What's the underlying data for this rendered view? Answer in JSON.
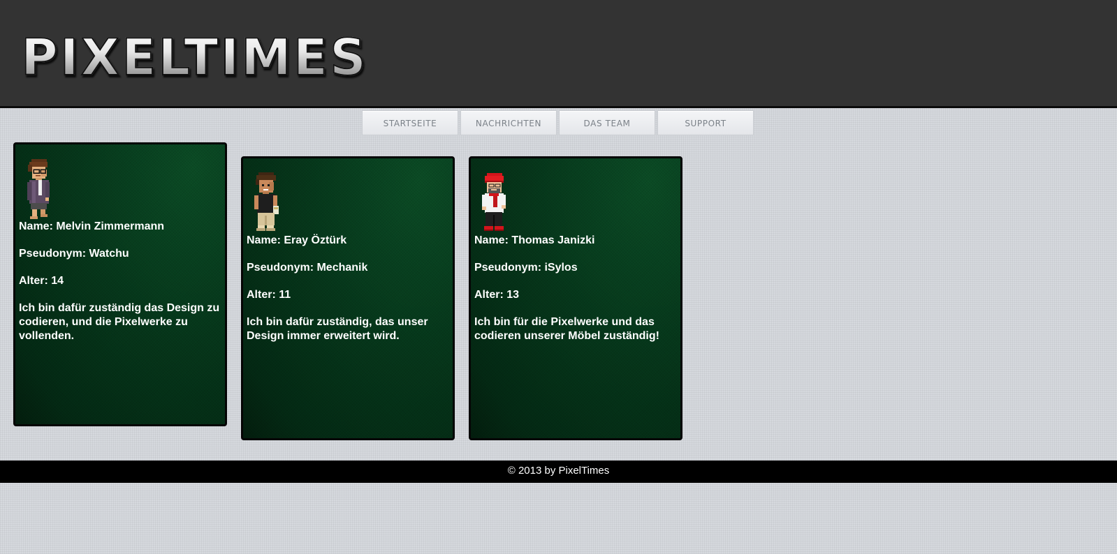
{
  "header": {
    "logo_text": "PIXELTIMES"
  },
  "nav": {
    "items": [
      {
        "label": "STARTSEITE"
      },
      {
        "label": "NACHRICHTEN"
      },
      {
        "label": "DAS TEAM"
      },
      {
        "label": "SUPPORT"
      }
    ]
  },
  "team": [
    {
      "name": "Name: Melvin Zimmermann",
      "pseudonym": "Pseudonym: Watchu",
      "age": "Alter: 14",
      "description": "Ich bin dafür zuständig das Design zu codieren, und die Pixelwerke zu vollenden."
    },
    {
      "name": "Name: Eray Öztürk",
      "pseudonym": "Pseudonym: Mechanik",
      "age": "Alter: 11",
      "description": "Ich bin dafür zuständig, das unser Design immer erweitert wird."
    },
    {
      "name": "Name: Thomas Janizki",
      "pseudonym": "Pseudonym: iSylos",
      "age": "Alter: 13",
      "description": "Ich bin für die Pixelwerke und das codieren unserer Möbel zuständig!"
    }
  ],
  "footer": {
    "text": "© 2013 by PixelTimes"
  },
  "colors": {
    "header_bg": "#333333",
    "page_bg": "#d6d9de",
    "card_green": "#06391c",
    "footer_bg": "#000000"
  },
  "icons": [
    "avatar-watchu-icon",
    "avatar-mechanik-icon",
    "avatar-isylos-icon"
  ]
}
